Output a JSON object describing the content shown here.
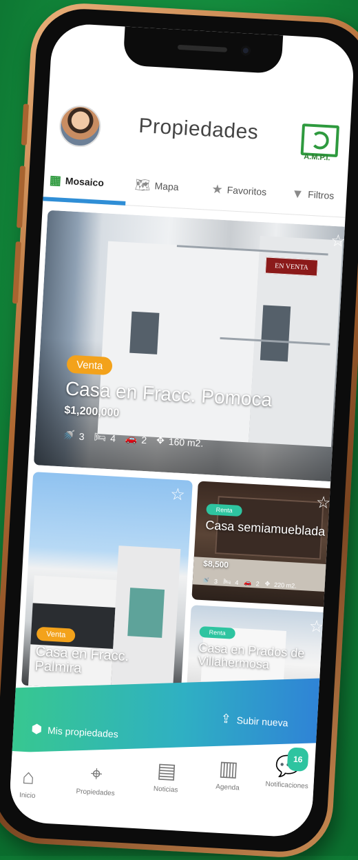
{
  "header": {
    "title": "Propiedades",
    "logo_text": "A.M.P.I."
  },
  "tabs": [
    {
      "label": "Mosaico",
      "icon": "grid-icon",
      "active": true
    },
    {
      "label": "Mapa",
      "icon": "map-icon",
      "active": false
    },
    {
      "label": "Favoritos",
      "icon": "star-icon",
      "active": false
    },
    {
      "label": "Filtros",
      "icon": "filter-icon",
      "active": false
    }
  ],
  "listings": [
    {
      "badge": "Venta",
      "title": "Casa en Fracc. Pomoca",
      "price": "$1,200,000",
      "baths": "3",
      "beds": "4",
      "parking": "2",
      "area": "160 m2.",
      "sign_text": "EN VENTA"
    },
    {
      "badge": "Venta",
      "title": "Casa en Fracc. Palmira"
    },
    {
      "badge": "Renta",
      "title": "Casa semiamueblada",
      "price": "$8,500",
      "baths": "3",
      "beds": "4",
      "parking": "2",
      "area": "220 m2."
    },
    {
      "badge": "Renta",
      "title": "Casa en Prados de Villahermosa"
    }
  ],
  "actions": {
    "my_properties": "Mis propiedades",
    "upload_new": "Subir nueva"
  },
  "bottom_nav": [
    {
      "label": "Inicio",
      "icon": "home-icon"
    },
    {
      "label": "Propiedades",
      "icon": "location-pin-icon"
    },
    {
      "label": "Noticias",
      "icon": "newspaper-icon"
    },
    {
      "label": "Agenda",
      "icon": "agenda-icon"
    },
    {
      "label": "Notificaciones",
      "icon": "chat-bubble-icon",
      "badge": "16"
    }
  ],
  "colors": {
    "background_green": "#138a3c",
    "accent_blue": "#2f8ed6",
    "venta_orange": "#f3a21b",
    "renta_teal": "#2ec4a0"
  }
}
